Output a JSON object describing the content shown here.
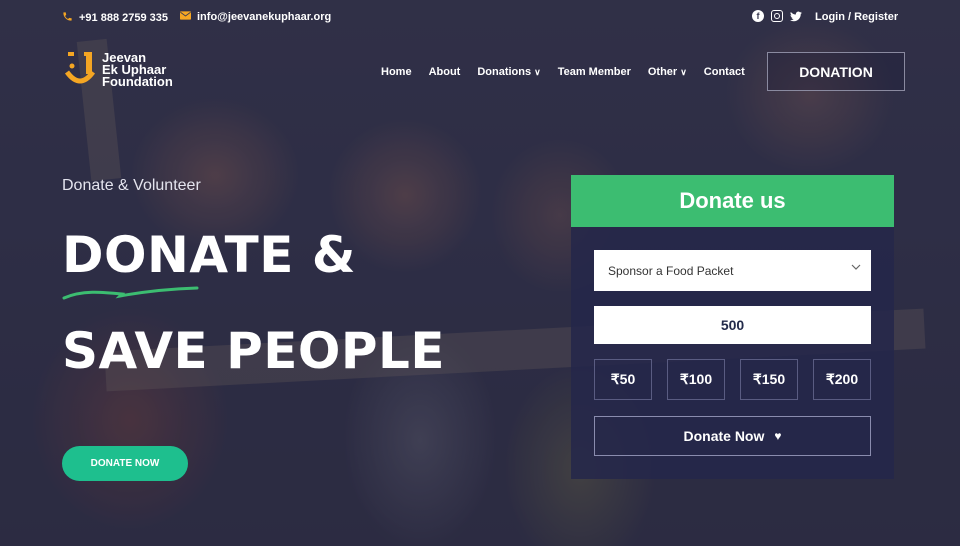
{
  "colors": {
    "accent_orange": "#f5a623",
    "panel_green": "#3cbd71",
    "cta_green": "#1ebf8e",
    "panel_navy": "#25274a"
  },
  "topbar": {
    "phone": "+91 888 2759 335",
    "email": "info@jeevanekuphaar.org",
    "socials": [
      "facebook-icon",
      "instagram-icon",
      "twitter-icon"
    ],
    "login": "Login / Register"
  },
  "header": {
    "logo_lines": [
      "Jeevan",
      "Ek Uphaar",
      "Foundation"
    ],
    "nav": [
      {
        "label": "Home",
        "dropdown": false
      },
      {
        "label": "About",
        "dropdown": false
      },
      {
        "label": "Donations",
        "dropdown": true
      },
      {
        "label": "Team Member",
        "dropdown": false
      },
      {
        "label": "Other",
        "dropdown": true
      },
      {
        "label": "Contact",
        "dropdown": false
      }
    ],
    "donation_button": "DONATION"
  },
  "hero": {
    "eyebrow": "Donate & Volunteer",
    "headline_line1": "DONATE &",
    "headline_line2": "SAVE PEOPLE",
    "cta": "DONATE NOW"
  },
  "donate_panel": {
    "title": "Donate us",
    "select_value": "Sponsor a Food Packet",
    "amount_value": "500",
    "presets": [
      "₹50",
      "₹100",
      "₹150",
      "₹200"
    ],
    "submit": "Donate Now"
  }
}
